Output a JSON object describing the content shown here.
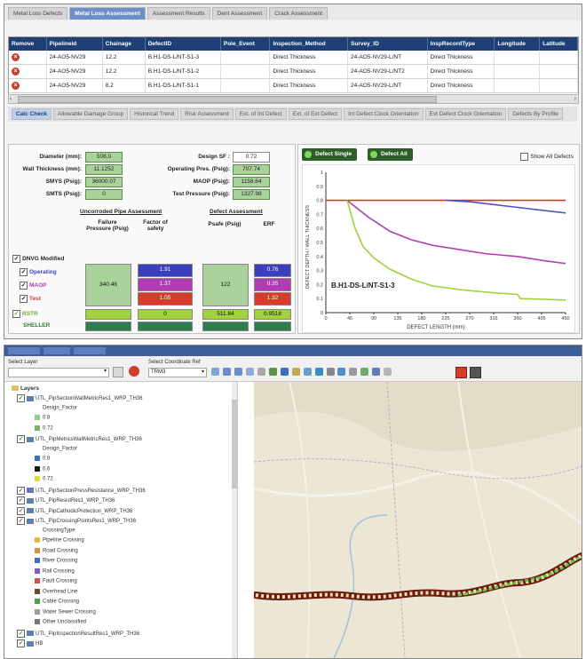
{
  "top": {
    "tabs": [
      {
        "label": "Metal Loss Defects"
      },
      {
        "label": "Metal Loss Assessment"
      },
      {
        "label": "Assessment Results"
      },
      {
        "label": "Dent Assessment"
      },
      {
        "label": "Crack Assessment"
      }
    ],
    "table": {
      "columns": [
        "Remove",
        "Pipelineid",
        "Chainage",
        "DefectID",
        "Pole_Event",
        "Inspection_Method",
        "Survey_ID",
        "InspRecordType",
        "Longitude",
        "Latitude"
      ],
      "rows": [
        [
          "24-AO5-NV29",
          "12.2",
          "B.H1-DS-L/NT-S1-3",
          "",
          "Direct Thickness",
          "24-AO5-NV29-L/NT",
          "Direct Thickness",
          "",
          ""
        ],
        [
          "24-AO5-NV29",
          "12.2",
          "B.H1-DS-L/NT-S1-2",
          "",
          "Direct Thickness",
          "24-AO5-NV29-L/NT2",
          "Direct Thickness",
          "",
          ""
        ],
        [
          "24-AO5-NV29",
          "8.2",
          "B.H1-DS-L/NT-S1-1",
          "",
          "Direct Thickness",
          "24-AO5-NV29-L/NT",
          "Direct Thickness",
          "",
          ""
        ]
      ]
    },
    "subtabs": [
      {
        "label": "Calc Check"
      },
      {
        "label": "Allowable Damage Group"
      },
      {
        "label": "Historical Trend"
      },
      {
        "label": "Risk Assessment"
      },
      {
        "label": "Ext. of Int Defect"
      },
      {
        "label": "Ext. of Ext Defect"
      },
      {
        "label": "Int Defect Clock Orientation"
      },
      {
        "label": "Ext Defect Clock Orientation"
      },
      {
        "label": "Defects By Profile"
      }
    ],
    "params_left": [
      {
        "label": "Diameter (mm):",
        "value": "508.0"
      },
      {
        "label": "Wall Thickness (mm):",
        "value": "11.1252"
      },
      {
        "label": "SMYS (Psig):",
        "value": "36000.07"
      },
      {
        "label": "SMTS (Psig):",
        "value": "0"
      }
    ],
    "params_right": [
      {
        "label": "Design SF :",
        "value": "0.72"
      },
      {
        "label": "Operating Pres. (Psig):",
        "value": "707.74"
      },
      {
        "label": "MAOP (Psig):",
        "value": "1158.64"
      },
      {
        "label": "Test Pressure (Psig):",
        "value": "1327.98"
      }
    ],
    "uncorroded_title": "Uncorroded Pipe Assessment",
    "defect_title": "Defect Assessment",
    "col_failure": "Failure Pressure (Psig)",
    "col_factor": "Factor of safety",
    "col_pasafe": "Psafe (Psig)",
    "col_erf": "ERF",
    "dnv_label": "DNVG Modified",
    "row_labels": [
      "Operating",
      "MAOP",
      "Test"
    ],
    "row_colors": [
      "#3b3fbf",
      "#b23ab2",
      "#d93a2a"
    ],
    "failure_value": "340.46",
    "psafe_value": "122",
    "factor_values": [
      "1.91",
      "1.37",
      "1.05"
    ],
    "erf_values": [
      "0.76",
      "0.35",
      "1.32"
    ],
    "rstreng_label": "RSTR",
    "rstreng_factor": "0",
    "rstreng_psafe": "511.84",
    "rstreng_erf": "0.9518",
    "shell_label": "SHELLER",
    "buttons": {
      "single": "Defect Single",
      "all": "Defect All",
      "show_all": "Show All Defects"
    },
    "chart_data": {
      "type": "line",
      "xlabel": "DEFECT LENGTH (mm)",
      "ylabel": "DEFECT DEPTH / WALL THICKNESS",
      "annotation": "B.H1-DS-L/NT-S1-3",
      "ylim": [
        0,
        1
      ],
      "xticks": [
        "0",
        "45",
        "90",
        "135",
        "180",
        "225",
        "270",
        "315",
        "360",
        "405",
        "450"
      ],
      "yticks": [
        "0",
        "0.1",
        "0.2",
        "0.3",
        "0.4",
        "0.5",
        "0.6",
        "0.7",
        "0.8",
        "0.9",
        "1"
      ],
      "series": [
        {
          "color": "#e0312a",
          "points": [
            [
              0,
              0.8
            ],
            [
              450,
              0.8
            ]
          ]
        },
        {
          "color": "#4655c9",
          "points": [
            [
              225,
              0.8
            ],
            [
              270,
              0.79
            ],
            [
              315,
              0.77
            ],
            [
              360,
              0.75
            ],
            [
              405,
              0.73
            ],
            [
              450,
              0.71
            ]
          ]
        },
        {
          "color": "#b23fb0",
          "points": [
            [
              40,
              0.8
            ],
            [
              80,
              0.68
            ],
            [
              120,
              0.58
            ],
            [
              160,
              0.52
            ],
            [
              200,
              0.48
            ],
            [
              250,
              0.45
            ],
            [
              300,
              0.42
            ],
            [
              360,
              0.4
            ],
            [
              410,
              0.37
            ],
            [
              450,
              0.35
            ]
          ]
        },
        {
          "color": "#9fd23b",
          "points": [
            [
              40,
              0.8
            ],
            [
              55,
              0.6
            ],
            [
              70,
              0.47
            ],
            [
              90,
              0.39
            ],
            [
              120,
              0.31
            ],
            [
              160,
              0.24
            ],
            [
              200,
              0.19
            ],
            [
              260,
              0.16
            ],
            [
              320,
              0.14
            ],
            [
              360,
              0.13
            ],
            [
              365,
              0.1
            ],
            [
              450,
              0.09
            ]
          ]
        }
      ]
    }
  },
  "bottom": {
    "select_layer": "Select Layer",
    "coord_label": "Select Coordinate Ref",
    "coord_value": "TRM3",
    "layers_root": "Layers",
    "tree": [
      {
        "text": "UTL_PipSectionWallMetricRes1_WRP_TH36",
        "indent": 1
      },
      {
        "text": "Design_Factor",
        "indent": 2
      },
      {
        "text": "0.8",
        "indent": 2
      },
      {
        "text": "0.72",
        "indent": 2
      },
      {
        "text": "UTL_PipMetricsWallMetricRes1_WRP_TH36",
        "indent": 1
      },
      {
        "text": "Design_Factor",
        "indent": 2
      },
      {
        "text": "0.8",
        "indent": 2
      },
      {
        "text": "0.6",
        "indent": 2
      },
      {
        "text": "0.72",
        "indent": 2
      },
      {
        "text": "UTL_PipSectionPressResistance_WRP_TH36",
        "indent": 1
      },
      {
        "text": "UTL_PipResistRes1_WRP_TH36",
        "indent": 1
      },
      {
        "text": "UTL_PipCathodicProtection_WRP_TH36",
        "indent": 1
      },
      {
        "text": "UTL_PipCrossingPointsRes1_WRP_TH36",
        "indent": 1
      },
      {
        "text": "CrossingType",
        "indent": 2
      },
      {
        "text": "Pipeline Crossing",
        "indent": 2
      },
      {
        "text": "Road Crossing",
        "indent": 2
      },
      {
        "text": "River Crossing",
        "indent": 2
      },
      {
        "text": "Rail Crossing",
        "indent": 2
      },
      {
        "text": "Fault Crossing",
        "indent": 2
      },
      {
        "text": "Overhead Line",
        "indent": 2
      },
      {
        "text": "Cable Crossing",
        "indent": 2
      },
      {
        "text": "Water Sewer Crossing",
        "indent": 2
      },
      {
        "text": "Other Unclassified",
        "indent": 2
      },
      {
        "text": "UTL_PipInspectionResultRes1_WRP_TH36",
        "indent": 1
      },
      {
        "text": "HB",
        "indent": 1
      }
    ],
    "tree_swatches": [
      "",
      "",
      "#8fd18a",
      "#7fae67",
      "",
      "",
      "#3b6fb8",
      "#1d1d1d",
      "#e3d63a",
      "",
      "",
      "",
      "",
      "",
      "#e6b64c",
      "#d78f3a",
      "#3b6fb8",
      "#8a5cc2",
      "#d05252",
      "#6b4b2a",
      "#4aa04a",
      "#9c9c9c",
      "#777777",
      "",
      ""
    ]
  }
}
